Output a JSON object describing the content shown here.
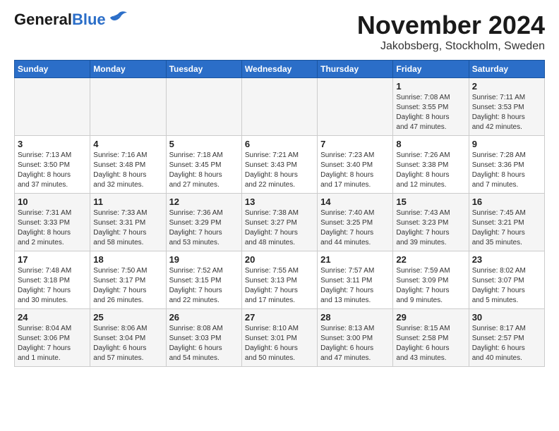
{
  "logo": {
    "general": "General",
    "blue": "Blue"
  },
  "title": "November 2024",
  "subtitle": "Jakobsberg, Stockholm, Sweden",
  "headers": [
    "Sunday",
    "Monday",
    "Tuesday",
    "Wednesday",
    "Thursday",
    "Friday",
    "Saturday"
  ],
  "weeks": [
    [
      {
        "day": "",
        "info": ""
      },
      {
        "day": "",
        "info": ""
      },
      {
        "day": "",
        "info": ""
      },
      {
        "day": "",
        "info": ""
      },
      {
        "day": "",
        "info": ""
      },
      {
        "day": "1",
        "info": "Sunrise: 7:08 AM\nSunset: 3:55 PM\nDaylight: 8 hours\nand 47 minutes."
      },
      {
        "day": "2",
        "info": "Sunrise: 7:11 AM\nSunset: 3:53 PM\nDaylight: 8 hours\nand 42 minutes."
      }
    ],
    [
      {
        "day": "3",
        "info": "Sunrise: 7:13 AM\nSunset: 3:50 PM\nDaylight: 8 hours\nand 37 minutes."
      },
      {
        "day": "4",
        "info": "Sunrise: 7:16 AM\nSunset: 3:48 PM\nDaylight: 8 hours\nand 32 minutes."
      },
      {
        "day": "5",
        "info": "Sunrise: 7:18 AM\nSunset: 3:45 PM\nDaylight: 8 hours\nand 27 minutes."
      },
      {
        "day": "6",
        "info": "Sunrise: 7:21 AM\nSunset: 3:43 PM\nDaylight: 8 hours\nand 22 minutes."
      },
      {
        "day": "7",
        "info": "Sunrise: 7:23 AM\nSunset: 3:40 PM\nDaylight: 8 hours\nand 17 minutes."
      },
      {
        "day": "8",
        "info": "Sunrise: 7:26 AM\nSunset: 3:38 PM\nDaylight: 8 hours\nand 12 minutes."
      },
      {
        "day": "9",
        "info": "Sunrise: 7:28 AM\nSunset: 3:36 PM\nDaylight: 8 hours\nand 7 minutes."
      }
    ],
    [
      {
        "day": "10",
        "info": "Sunrise: 7:31 AM\nSunset: 3:33 PM\nDaylight: 8 hours\nand 2 minutes."
      },
      {
        "day": "11",
        "info": "Sunrise: 7:33 AM\nSunset: 3:31 PM\nDaylight: 7 hours\nand 58 minutes."
      },
      {
        "day": "12",
        "info": "Sunrise: 7:36 AM\nSunset: 3:29 PM\nDaylight: 7 hours\nand 53 minutes."
      },
      {
        "day": "13",
        "info": "Sunrise: 7:38 AM\nSunset: 3:27 PM\nDaylight: 7 hours\nand 48 minutes."
      },
      {
        "day": "14",
        "info": "Sunrise: 7:40 AM\nSunset: 3:25 PM\nDaylight: 7 hours\nand 44 minutes."
      },
      {
        "day": "15",
        "info": "Sunrise: 7:43 AM\nSunset: 3:23 PM\nDaylight: 7 hours\nand 39 minutes."
      },
      {
        "day": "16",
        "info": "Sunrise: 7:45 AM\nSunset: 3:21 PM\nDaylight: 7 hours\nand 35 minutes."
      }
    ],
    [
      {
        "day": "17",
        "info": "Sunrise: 7:48 AM\nSunset: 3:18 PM\nDaylight: 7 hours\nand 30 minutes."
      },
      {
        "day": "18",
        "info": "Sunrise: 7:50 AM\nSunset: 3:17 PM\nDaylight: 7 hours\nand 26 minutes."
      },
      {
        "day": "19",
        "info": "Sunrise: 7:52 AM\nSunset: 3:15 PM\nDaylight: 7 hours\nand 22 minutes."
      },
      {
        "day": "20",
        "info": "Sunrise: 7:55 AM\nSunset: 3:13 PM\nDaylight: 7 hours\nand 17 minutes."
      },
      {
        "day": "21",
        "info": "Sunrise: 7:57 AM\nSunset: 3:11 PM\nDaylight: 7 hours\nand 13 minutes."
      },
      {
        "day": "22",
        "info": "Sunrise: 7:59 AM\nSunset: 3:09 PM\nDaylight: 7 hours\nand 9 minutes."
      },
      {
        "day": "23",
        "info": "Sunrise: 8:02 AM\nSunset: 3:07 PM\nDaylight: 7 hours\nand 5 minutes."
      }
    ],
    [
      {
        "day": "24",
        "info": "Sunrise: 8:04 AM\nSunset: 3:06 PM\nDaylight: 7 hours\nand 1 minute."
      },
      {
        "day": "25",
        "info": "Sunrise: 8:06 AM\nSunset: 3:04 PM\nDaylight: 6 hours\nand 57 minutes."
      },
      {
        "day": "26",
        "info": "Sunrise: 8:08 AM\nSunset: 3:03 PM\nDaylight: 6 hours\nand 54 minutes."
      },
      {
        "day": "27",
        "info": "Sunrise: 8:10 AM\nSunset: 3:01 PM\nDaylight: 6 hours\nand 50 minutes."
      },
      {
        "day": "28",
        "info": "Sunrise: 8:13 AM\nSunset: 3:00 PM\nDaylight: 6 hours\nand 47 minutes."
      },
      {
        "day": "29",
        "info": "Sunrise: 8:15 AM\nSunset: 2:58 PM\nDaylight: 6 hours\nand 43 minutes."
      },
      {
        "day": "30",
        "info": "Sunrise: 8:17 AM\nSunset: 2:57 PM\nDaylight: 6 hours\nand 40 minutes."
      }
    ]
  ]
}
